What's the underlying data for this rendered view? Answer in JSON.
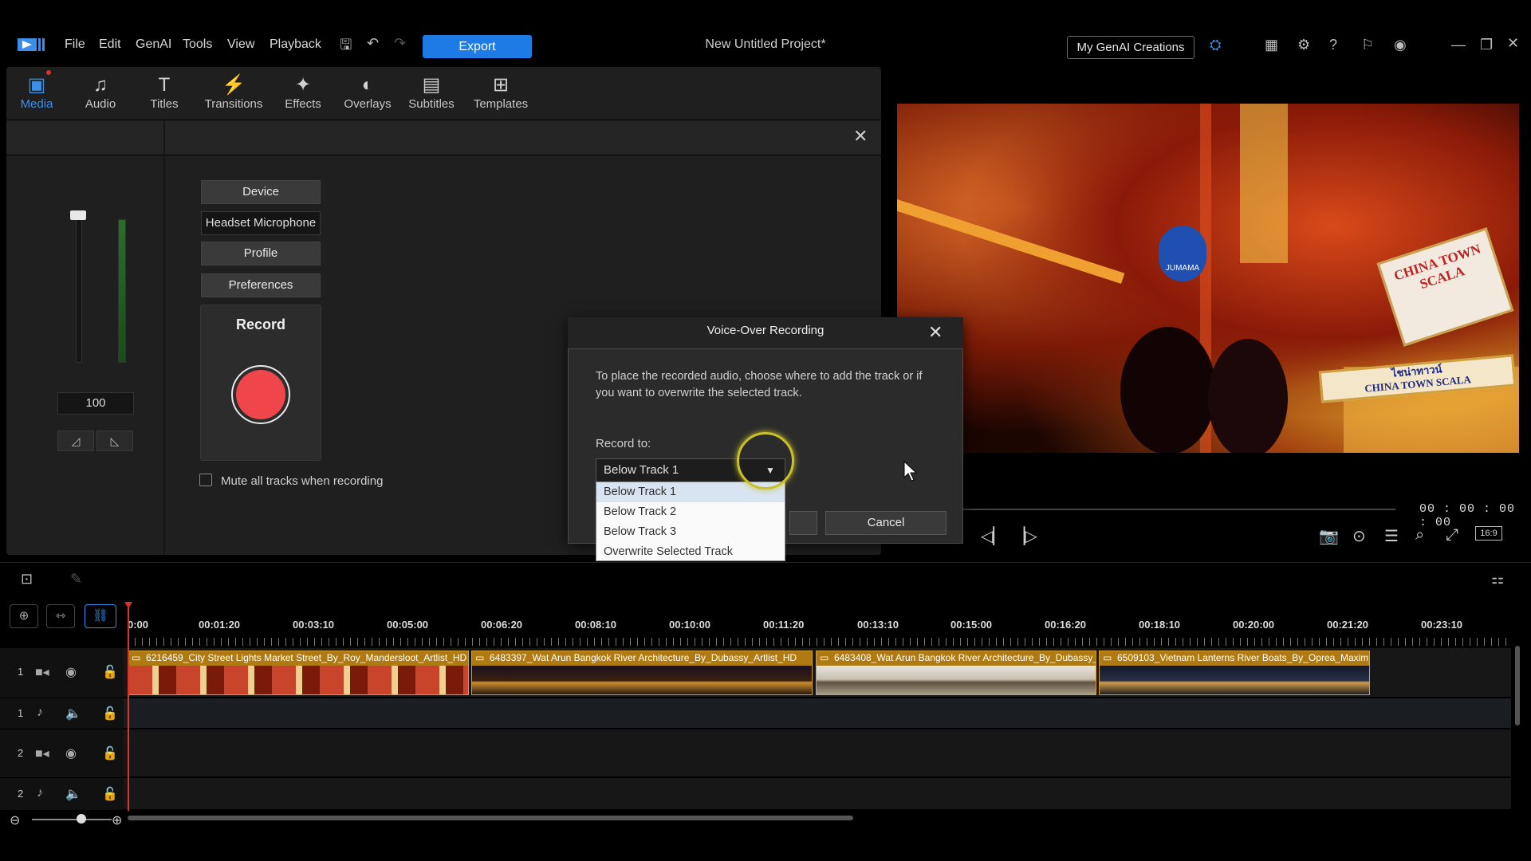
{
  "app": {
    "logo": "PowerDirector",
    "project_title": "New Untitled Project*"
  },
  "menubar": {
    "items": [
      "File",
      "Edit",
      "GenAI",
      "Tools",
      "View",
      "Playback"
    ],
    "export_label": "Export",
    "genai_creations_label": "My GenAI Creations"
  },
  "tabs": [
    "Media",
    "Audio",
    "Titles",
    "Transitions",
    "Effects",
    "Overlays",
    "Subtitles",
    "Templates"
  ],
  "recording": {
    "volume_value": "100",
    "device_label": "Device",
    "device_value": "Headset Microphone",
    "profile_label": "Profile",
    "preferences_label": "Preferences",
    "record_label": "Record",
    "mute_label": "Mute all tracks when recording",
    "mute_checked": false
  },
  "dialog": {
    "title": "Voice-Over Recording",
    "message": "To place the recorded audio, choose where to add the track or if you want to overwrite the selected track.",
    "record_to_label": "Record to:",
    "selected": "Below Track 1",
    "options": [
      "Below Track 1",
      "Below Track 2",
      "Below Track 3",
      "Overwrite Selected Track"
    ],
    "cancel_label": "Cancel"
  },
  "preview": {
    "timecode": "00 : 00 : 00 : 00",
    "aspect_label": "16:9",
    "signs": {
      "china_town": "CHINA TOWN\nSCALA",
      "scala_thai": "ไชน่าทาวน์\nCHINA TOWN SCALA",
      "jumama": "JUMAMA"
    }
  },
  "timeline": {
    "ruler": [
      "0:00",
      "00:01:20",
      "00:03:10",
      "00:05:00",
      "00:06:20",
      "00:08:10",
      "00:10:00",
      "00:11:20",
      "00:13:10",
      "00:15:00",
      "00:16:20",
      "00:18:10",
      "00:20:00",
      "00:21:20",
      "00:23:10"
    ],
    "tracks": [
      {
        "num": "1",
        "type": "video"
      },
      {
        "num": "1",
        "type": "audio"
      },
      {
        "num": "2",
        "type": "video"
      },
      {
        "num": "2",
        "type": "audio"
      }
    ],
    "clips": [
      "6216459_City Street Lights Market Street_By_Roy_Mandersloot_Artlist_HD",
      "6483397_Wat Arun Bangkok River Architecture_By_Dubassy_Artlist_HD",
      "6483408_Wat Arun Bangkok River Architecture_By_Dubassy_",
      "6509103_Vietnam Lanterns River Boats_By_Oprea_Maxim_"
    ]
  },
  "colors": {
    "accent": "#1e7be6",
    "record": "#f0454a",
    "clip": "#b07a12"
  }
}
